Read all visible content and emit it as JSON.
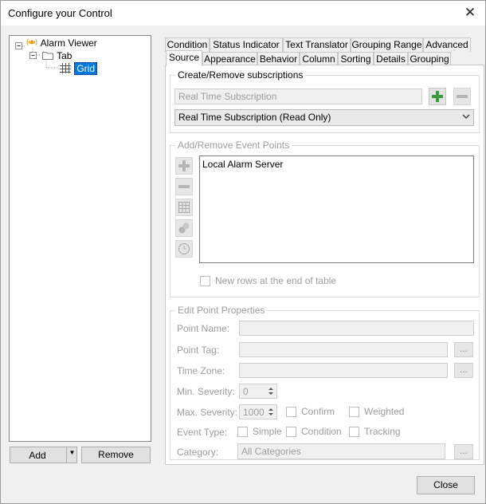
{
  "window": {
    "title": "Configure your Control",
    "close_label": "✕"
  },
  "tree": {
    "items": [
      {
        "label": "Alarm Viewer"
      },
      {
        "label": "Tab"
      },
      {
        "label": "Grid"
      }
    ]
  },
  "left_buttons": {
    "add": "Add",
    "remove": "Remove"
  },
  "tabs_row1": [
    "Condition",
    "Status Indicator",
    "Text Translator",
    "Grouping Range",
    "Advanced"
  ],
  "tabs_row2": [
    "Source",
    "Appearance",
    "Behavior",
    "Column",
    "Sorting",
    "Details",
    "Grouping"
  ],
  "subscriptions": {
    "group_label": "Create/Remove subscriptions",
    "name_value": "Real Time Subscription",
    "selected_option": "Real Time Subscription (Read Only)"
  },
  "event_points": {
    "group_label": "Add/Remove Event Points",
    "items": [
      "Local Alarm Server"
    ],
    "new_rows_label": "New rows at the end of table"
  },
  "point_props": {
    "group_label": "Edit Point Properties",
    "point_name_label": "Point Name:",
    "point_tag_label": "Point Tag:",
    "time_zone_label": "Time Zone:",
    "min_severity_label": "Min. Severity:",
    "min_severity_value": "0",
    "max_severity_label": "Max. Severity:",
    "max_severity_value": "1000",
    "confirm_label": "Confirm",
    "weighted_label": "Weighted",
    "event_type_label": "Event Type:",
    "simple_label": "Simple",
    "condition_label": "Condition",
    "tracking_label": "Tracking",
    "category_label": "Category:",
    "category_value": "All Categories",
    "ellipsis": "..."
  },
  "footer": {
    "close_label": "Close"
  }
}
